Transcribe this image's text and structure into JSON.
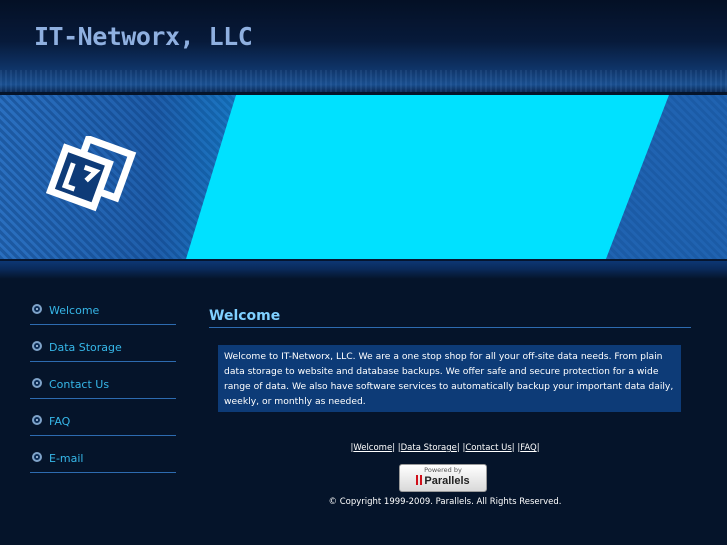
{
  "site": {
    "title": "IT-Networx, LLC"
  },
  "nav": {
    "items": [
      {
        "label": "Welcome"
      },
      {
        "label": "Data Storage"
      },
      {
        "label": "Contact Us"
      },
      {
        "label": "FAQ"
      },
      {
        "label": "E-mail"
      }
    ]
  },
  "main": {
    "heading": "Welcome",
    "body": "Welcome to IT-Networx, LLC. We are a one stop shop for all your off-site data needs. From plain data storage to website and database backups. We offer safe and secure protection for a wide range of data. We also have software services to automatically backup your important data daily, weekly, or monthly as needed."
  },
  "footer": {
    "links": [
      "Welcome",
      "Data Storage",
      "Contact Us",
      "FAQ"
    ],
    "badge_top": "Powered by",
    "badge_brand": "Parallels",
    "copyright": "© Copyright 1999-2009. Parallels. All Rights Reserved."
  },
  "colors": {
    "background": "#05142a",
    "nav_text": "#36b7e8",
    "heading": "#7fd0ff",
    "content_box": "#0d3b77",
    "banner_screen": "#00e1ff"
  }
}
